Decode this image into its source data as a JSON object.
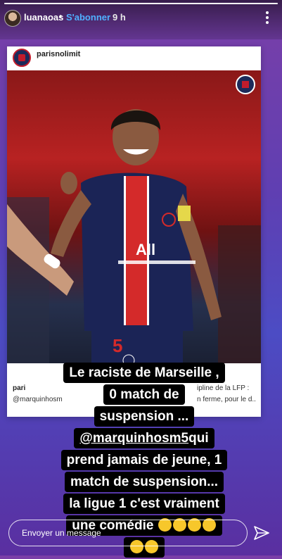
{
  "story": {
    "username": "luanaoas",
    "separator": "•",
    "subscribe_label": "S'abonner",
    "time_ago": "9 h",
    "progress": 1.0
  },
  "post": {
    "username": "parisnolimit",
    "caption_user": "pari",
    "caption_line1_right": "ipline de la LFP :",
    "caption_line2_left": "@marquinhosm",
    "caption_line2_right": "n ferme, pour le d..."
  },
  "sticker": {
    "lines": [
      "Le raciste de Marseille ,",
      "0 match de",
      "suspension ..."
    ],
    "mention": "@marquinhosm5",
    "line_after_mention": " qui",
    "lines_after": [
      "prend jamais de jeune, 1",
      "match de suspension...",
      "la ligue 1 c'est vraiment",
      "une comédie"
    ]
  },
  "reply": {
    "placeholder": "Envoyer un message"
  },
  "icons": {
    "more": "more-vertical-icon",
    "send": "send-icon"
  },
  "colors": {
    "subscribe": "#4fb0ff",
    "background_top": "#7a3fa8",
    "background_bottom": "#4c4cc4"
  }
}
